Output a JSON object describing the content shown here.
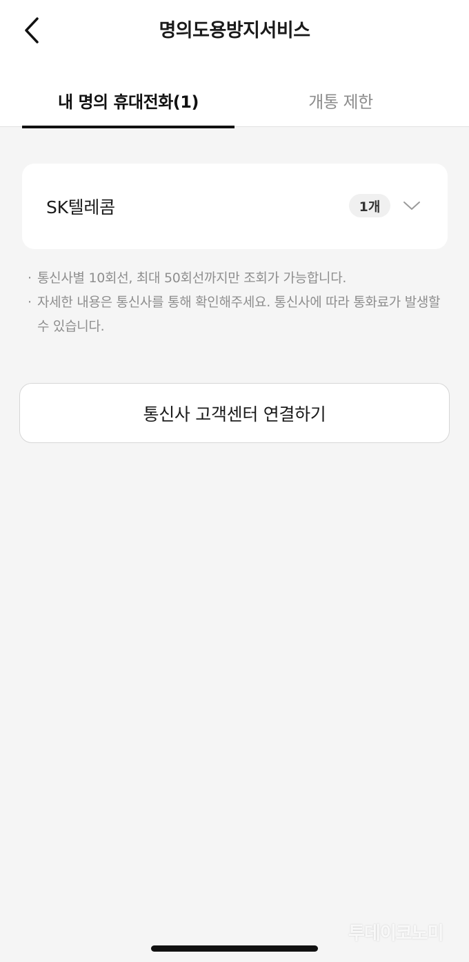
{
  "header": {
    "title": "명의도용방지서비스",
    "back_icon": "chevron-left-icon"
  },
  "tabs": [
    {
      "label": "내 명의 휴대전화(1)",
      "active": true
    },
    {
      "label": "개통 제한",
      "active": false
    }
  ],
  "carrier": {
    "name": "SK텔레콤",
    "count": "1개",
    "expand_icon": "chevron-down-icon"
  },
  "notes": [
    "통신사별 10회선, 최대 50회선까지만 조회가 가능합니다.",
    "자세한 내용은 통신사를 통해 확인해주세요. 통신사에 따라 통화료가 발생할 수 있습니다."
  ],
  "connect_button": {
    "label": "통신사 고객센터 연결하기"
  },
  "watermark": {
    "text": "투데이코노미"
  },
  "colors": {
    "background": "#f5f5f5",
    "card": "#ffffff",
    "primary_text": "#1a1a1a",
    "secondary_text": "#8e8e8e",
    "active_tab_underline": "#111111"
  }
}
